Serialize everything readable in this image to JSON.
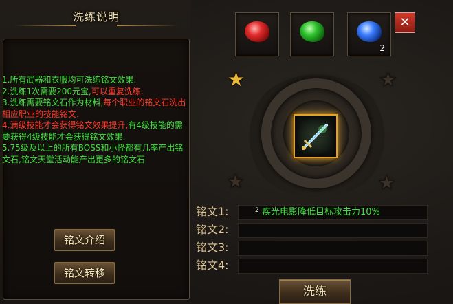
{
  "panel": {
    "title": "洗练说明",
    "rules": [
      {
        "num": "1.",
        "parts": [
          {
            "c": "g",
            "t": "所有武器和衣服均可洗练铭文效果."
          }
        ]
      },
      {
        "num": "2.",
        "parts": [
          {
            "c": "g",
            "t": "洗练1次需要200元宝,"
          },
          {
            "c": "r",
            "t": "可以重复洗练."
          }
        ]
      },
      {
        "num": "3.",
        "parts": [
          {
            "c": "g",
            "t": "洗练需要铭文石作为材料,"
          },
          {
            "c": "r",
            "t": "每个职业的铭文石洗出相应职业的技能铭文."
          }
        ]
      },
      {
        "num": "4.",
        "parts": [
          {
            "c": "r",
            "t": "满级技能才会获得铭文效果提升,"
          },
          {
            "c": "g",
            "t": "有4级技能的需要获得4级技能才会获得铭文效果."
          }
        ]
      },
      {
        "num": "5.",
        "parts": [
          {
            "c": "g",
            "t": "75级及以上的所有BOSS和小怪都有几率产出铭文石,铭文天堂活动能产出更多的铭文石"
          }
        ]
      }
    ],
    "buttons": {
      "intro": "铭文介绍",
      "transfer": "铭文转移"
    }
  },
  "gems": [
    {
      "color": "red",
      "count": ""
    },
    {
      "color": "green",
      "count": ""
    },
    {
      "color": "blue",
      "count": "2"
    }
  ],
  "close_icon": "close-icon",
  "runes": [
    {
      "label": "铭文1:",
      "value": "疾光电影降低目标攻击力10%",
      "index": "2"
    },
    {
      "label": "铭文2:",
      "value": "",
      "index": ""
    },
    {
      "label": "铭文3:",
      "value": "",
      "index": ""
    },
    {
      "label": "铭文4:",
      "value": "",
      "index": ""
    }
  ],
  "refine_button": "洗练",
  "colors": {
    "green": "#3fe03f",
    "red": "#ff3a2a",
    "gold": "#e8b838"
  }
}
